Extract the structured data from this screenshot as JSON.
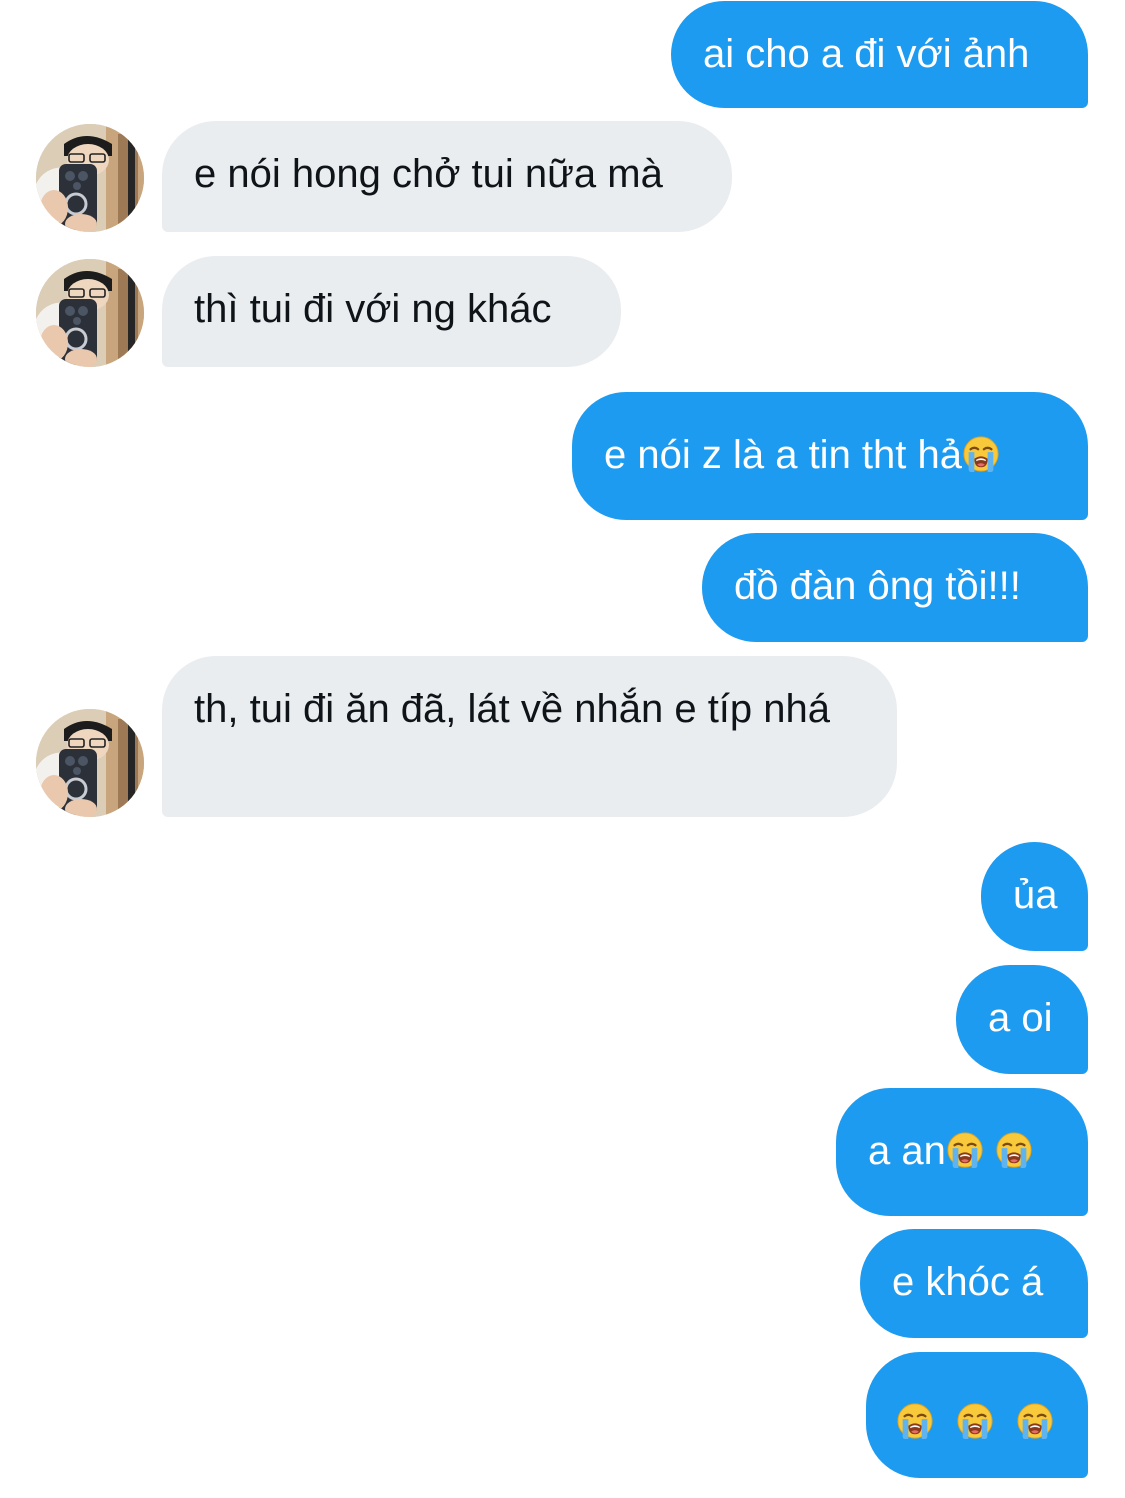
{
  "conversation": {
    "contact_avatar": "contact-avatar-photo",
    "messages": [
      {
        "from": "me",
        "text": "ai cho a đi với ảnh"
      },
      {
        "from": "them",
        "text": "e nói hong chở tui nữa mà"
      },
      {
        "from": "them",
        "text": "thì tui đi với ng khác"
      },
      {
        "from": "me",
        "text": "e nói z là a tin tht hả",
        "emoji": [
          "loudly-crying-face"
        ]
      },
      {
        "from": "me",
        "text": "đồ đàn ông tồi!!!"
      },
      {
        "from": "them",
        "text": "th, tui đi ăn đã, lát về nhắn e típ nhá"
      },
      {
        "from": "me",
        "text": "ủa"
      },
      {
        "from": "me",
        "text": "a oi"
      },
      {
        "from": "me",
        "text": "a an",
        "emoji": [
          "loudly-crying-face",
          "loudly-crying-face"
        ]
      },
      {
        "from": "me",
        "text": "e khóc á"
      },
      {
        "from": "me",
        "text": "",
        "emoji": [
          "loudly-crying-face",
          "loudly-crying-face",
          "loudly-crying-face"
        ]
      }
    ]
  },
  "colors": {
    "outgoing_bubble": "#1d9bf0",
    "incoming_bubble": "#eaedf0",
    "incoming_text": "#0f1419",
    "outgoing_text": "#ffffff"
  }
}
